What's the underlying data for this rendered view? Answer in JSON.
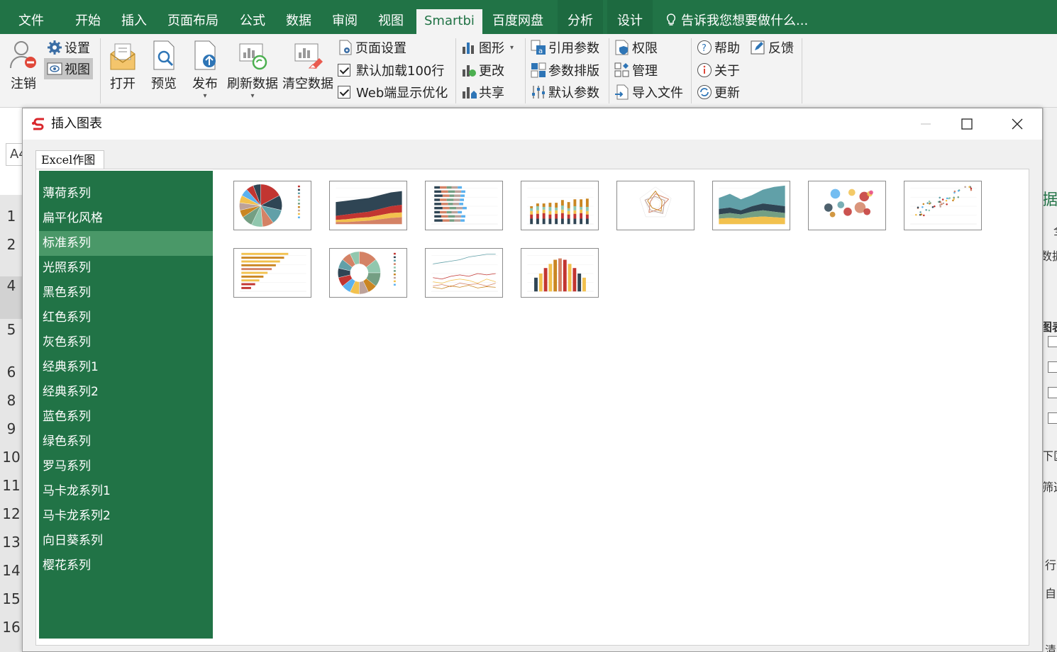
{
  "tabs": {
    "file": "文件",
    "home": "开始",
    "insert": "插入",
    "page_layout": "页面布局",
    "formulas": "公式",
    "data": "数据",
    "review": "审阅",
    "view": "视图",
    "smartbi": "Smartbi",
    "baidu": "百度网盘",
    "analyze": "分析",
    "design": "设计",
    "tell_me": "告诉我您想要做什么..."
  },
  "ribbon": {
    "logout": "注销",
    "settings": "设置",
    "view": "视图",
    "open": "打开",
    "preview": "预览",
    "publish": "发布",
    "refresh": "刷新数据",
    "clear": "清空数据",
    "page_setup": "页面设置",
    "load_default": "默认加载100行",
    "web_optimize": "Web端显示优化",
    "chart": "图形",
    "modify": "更改",
    "share": "共享",
    "ref_params": "引用参数",
    "param_layout": "参数排版",
    "default_params": "默认参数",
    "permission": "权限",
    "manage": "管理",
    "import_file": "导入文件",
    "help": "帮助",
    "feedback": "反馈",
    "about": "关于",
    "update": "更新"
  },
  "sheet": {
    "namebox": "A4",
    "rows": [
      "1",
      "2",
      "4",
      "5",
      "6",
      "8",
      "9",
      "10",
      "11",
      "12",
      "13",
      "14",
      "15",
      "16"
    ],
    "right_fragments": [
      "据源",
      "全",
      "数据",
      "图表",
      "下区",
      "筛选",
      "行",
      "自(",
      "清"
    ]
  },
  "dialog": {
    "title": "插入图表",
    "tab": "Excel作图",
    "series": [
      "薄荷系列",
      "扁平化风格",
      "标准系列",
      "光照系列",
      "黑色系列",
      "红色系列",
      "灰色系列",
      "经典系列1",
      "经典系列2",
      "蓝色系列",
      "绿色系列",
      "罗马系列",
      "马卡龙系列1",
      "马卡龙系列2",
      "向日葵系列",
      "樱花系列"
    ],
    "selected_series": "标准系列"
  },
  "colors": {
    "excel_green": "#217346",
    "selected_item": "#4a9868",
    "palette": [
      "#c23531",
      "#2f4554",
      "#61a0a8",
      "#d48265",
      "#91c7ae",
      "#749f83",
      "#ca8622",
      "#bda29a",
      "#f2c14e",
      "#5ab1ef"
    ]
  },
  "gallery": [
    {
      "kind": "pie",
      "icon": "pie-chart-icon"
    },
    {
      "kind": "stacked-area",
      "icon": "stacked-area-chart-icon"
    },
    {
      "kind": "stacked-hbar",
      "icon": "stacked-bar-chart-icon"
    },
    {
      "kind": "stacked-column",
      "icon": "stacked-column-chart-icon"
    },
    {
      "kind": "radar",
      "icon": "radar-chart-icon"
    },
    {
      "kind": "area",
      "icon": "area-chart-icon"
    },
    {
      "kind": "bubble",
      "icon": "bubble-chart-icon"
    },
    {
      "kind": "scatter",
      "icon": "scatter-chart-icon"
    },
    {
      "kind": "hbar",
      "icon": "horizontal-bar-chart-icon"
    },
    {
      "kind": "donut",
      "icon": "donut-chart-icon"
    },
    {
      "kind": "line",
      "icon": "line-chart-icon"
    },
    {
      "kind": "column",
      "icon": "column-chart-icon"
    }
  ]
}
